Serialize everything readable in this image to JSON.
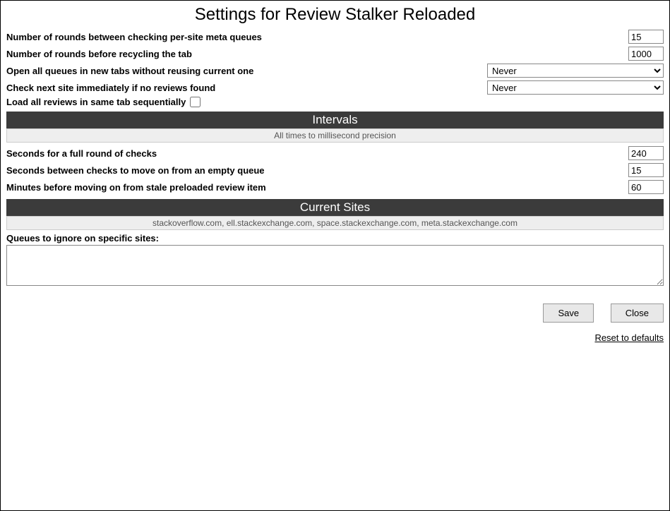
{
  "title": "Settings for Review Stalker Reloaded",
  "top": {
    "rounds_meta_label": "Number of rounds between checking per-site meta queues",
    "rounds_meta_value": "15",
    "rounds_recycle_label": "Number of rounds before recycling the tab",
    "rounds_recycle_value": "1000",
    "open_queues_label": "Open all queues in new tabs without reusing current one",
    "open_queues_value": "Never",
    "check_next_label": "Check next site immediately if no reviews found",
    "check_next_value": "Never",
    "select_options": [
      "Never"
    ],
    "load_seq_label": "Load all reviews in same tab sequentially"
  },
  "intervals": {
    "header": "Intervals",
    "sub": "All times to millisecond precision",
    "full_round_label": "Seconds for a full round of checks",
    "full_round_value": "240",
    "empty_queue_label": "Seconds between checks to move on from an empty queue",
    "empty_queue_value": "15",
    "stale_label": "Minutes before moving on from stale preloaded review item",
    "stale_value": "60"
  },
  "sites": {
    "header": "Current Sites",
    "list": "stackoverflow.com, ell.stackexchange.com, space.stackexchange.com, meta.stackexchange.com",
    "ignore_label": "Queues to ignore on specific sites:",
    "ignore_value": ""
  },
  "buttons": {
    "save": "Save",
    "close": "Close",
    "reset": "Reset to defaults"
  }
}
